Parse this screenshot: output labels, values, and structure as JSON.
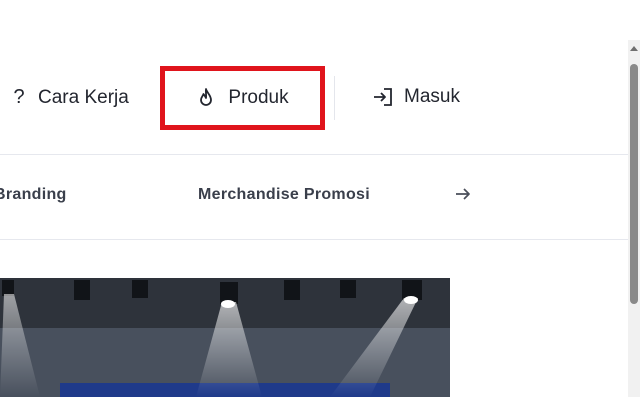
{
  "nav": {
    "how_it_works": {
      "label": "Cara Kerja",
      "icon": "question-icon"
    },
    "products": {
      "label": "Produk",
      "icon": "flame-icon",
      "highlight_color": "#e0141c"
    },
    "login": {
      "label": "Masuk",
      "icon": "login-icon"
    }
  },
  "categories": {
    "items": [
      {
        "label": "Branding"
      },
      {
        "label": "Merchandise Promosi"
      }
    ],
    "next_icon": "arrow-right-icon"
  },
  "hero": {
    "description_icon": "stage-spotlights-image"
  }
}
